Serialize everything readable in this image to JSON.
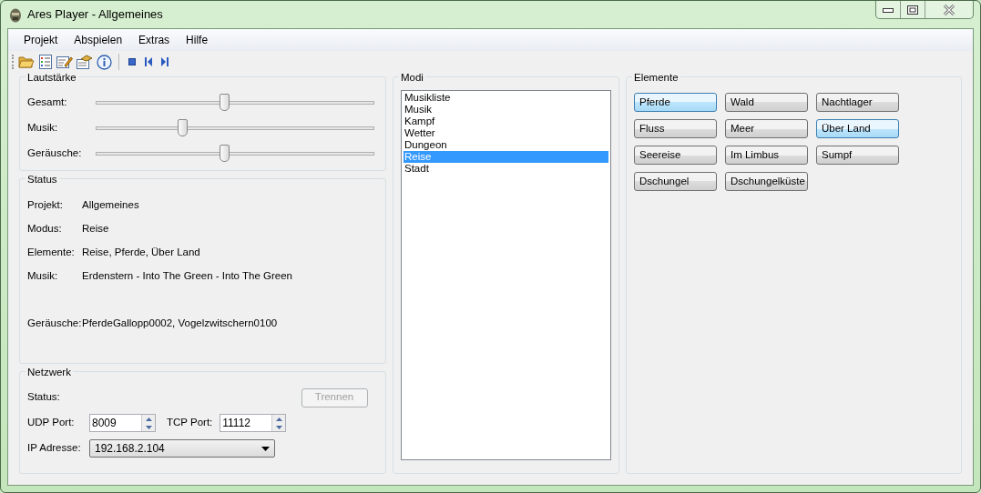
{
  "window": {
    "title": "Ares Player - Allgemeines"
  },
  "menu": [
    {
      "label": "Projekt"
    },
    {
      "label": "Abspielen"
    },
    {
      "label": "Extras"
    },
    {
      "label": "Hilfe"
    }
  ],
  "volume": {
    "title": "Lautstärke",
    "sliders": [
      {
        "label": "Gesamt:",
        "level": 0.46
      },
      {
        "label": "Musik:",
        "level": 0.31
      },
      {
        "label": "Geräusche:",
        "level": 0.46
      }
    ]
  },
  "status": {
    "title": "Status",
    "rows": [
      {
        "label": "Projekt:",
        "value": "Allgemeines"
      },
      {
        "label": "Modus:",
        "value": "Reise"
      },
      {
        "label": "Elemente:",
        "value": "Reise, Pferde, Über Land"
      },
      {
        "label": "Musik:",
        "value": "Erdenstern - Into The Green - Into The Green"
      },
      {
        "label": "Geräusche:",
        "value": "PferdeGallopp0002, Vogelzwitschern0100"
      }
    ]
  },
  "network": {
    "title": "Netzwerk",
    "status_label": "Status:",
    "disconnect_button": {
      "label": "Trennen",
      "disabled": true
    },
    "udp_label": "UDP Port:",
    "udp_port": "8009",
    "tcp_label": "TCP Port:",
    "tcp_port": "11112",
    "ip_label": "IP Adresse:",
    "ip_address": "192.168.2.104"
  },
  "modes": {
    "title": "Modi",
    "items": [
      {
        "label": "Musikliste",
        "selected": false
      },
      {
        "label": "Musik",
        "selected": false
      },
      {
        "label": "Kampf",
        "selected": false
      },
      {
        "label": "Wetter",
        "selected": false
      },
      {
        "label": "Dungeon",
        "selected": false
      },
      {
        "label": "Reise",
        "selected": true
      },
      {
        "label": "Stadt",
        "selected": false
      }
    ]
  },
  "elements": {
    "title": "Elemente",
    "buttons": [
      {
        "label": "Pferde",
        "selected": true
      },
      {
        "label": "Wald",
        "selected": false
      },
      {
        "label": "Nachtlager",
        "selected": false
      },
      {
        "label": "Fluss",
        "selected": false
      },
      {
        "label": "Meer",
        "selected": false
      },
      {
        "label": "Über Land",
        "selected": true
      },
      {
        "label": "Seereise",
        "selected": false
      },
      {
        "label": "Im Limbus",
        "selected": false
      },
      {
        "label": "Sumpf",
        "selected": false
      },
      {
        "label": "Dschungel",
        "selected": false
      },
      {
        "label": "Dschungelküste",
        "selected": false
      }
    ]
  }
}
